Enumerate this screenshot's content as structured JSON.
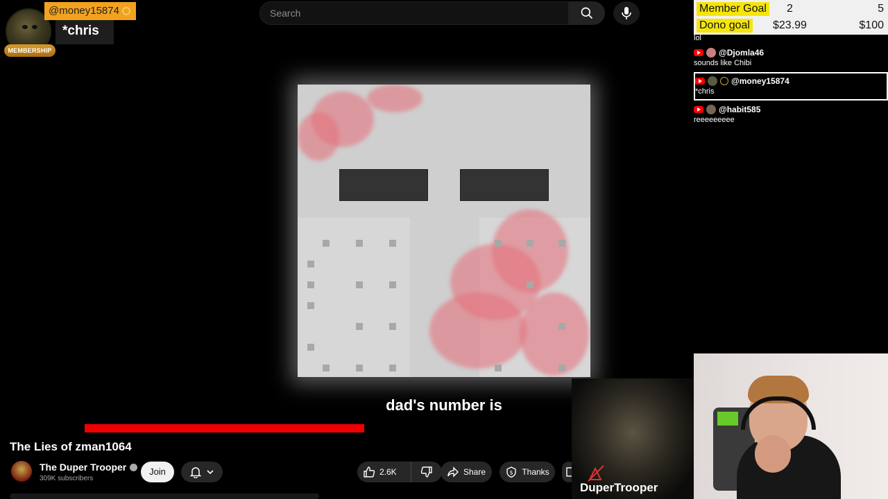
{
  "search": {
    "placeholder": "Search"
  },
  "membership": {
    "username": "@money15874",
    "badge_label": "MEMBERSHIP",
    "message": "*chris"
  },
  "video": {
    "caption": "dad's number is",
    "progress_fraction": 0.46,
    "title": "The Lies of zman1064"
  },
  "channel": {
    "name": "The Duper Trooper",
    "subscribers": "309K subscribers",
    "join_label": "Join"
  },
  "actions": {
    "likes": "2.6K",
    "share_label": "Share",
    "thanks_label": "Thanks"
  },
  "goals": {
    "member": {
      "label": "Member Goal",
      "current": "2",
      "target": "5"
    },
    "dono": {
      "label": "Dono goal",
      "current": "$23.99",
      "target": "$100"
    }
  },
  "chat": {
    "overflow_text": "lol",
    "messages": [
      {
        "user": "@Djomla46",
        "text": "sounds like Chibi"
      },
      {
        "user": "@money15874",
        "text": "*chris"
      },
      {
        "user": "@habit585",
        "text": "reeeeeeeee"
      }
    ]
  },
  "streamer_cam": {
    "label": "DuperTrooper"
  },
  "colors": {
    "membership_orange": "#f2a21f",
    "progress_red": "#ee0000",
    "goal_yellow": "#f5e50a",
    "youtube_red": "#ff0000"
  }
}
